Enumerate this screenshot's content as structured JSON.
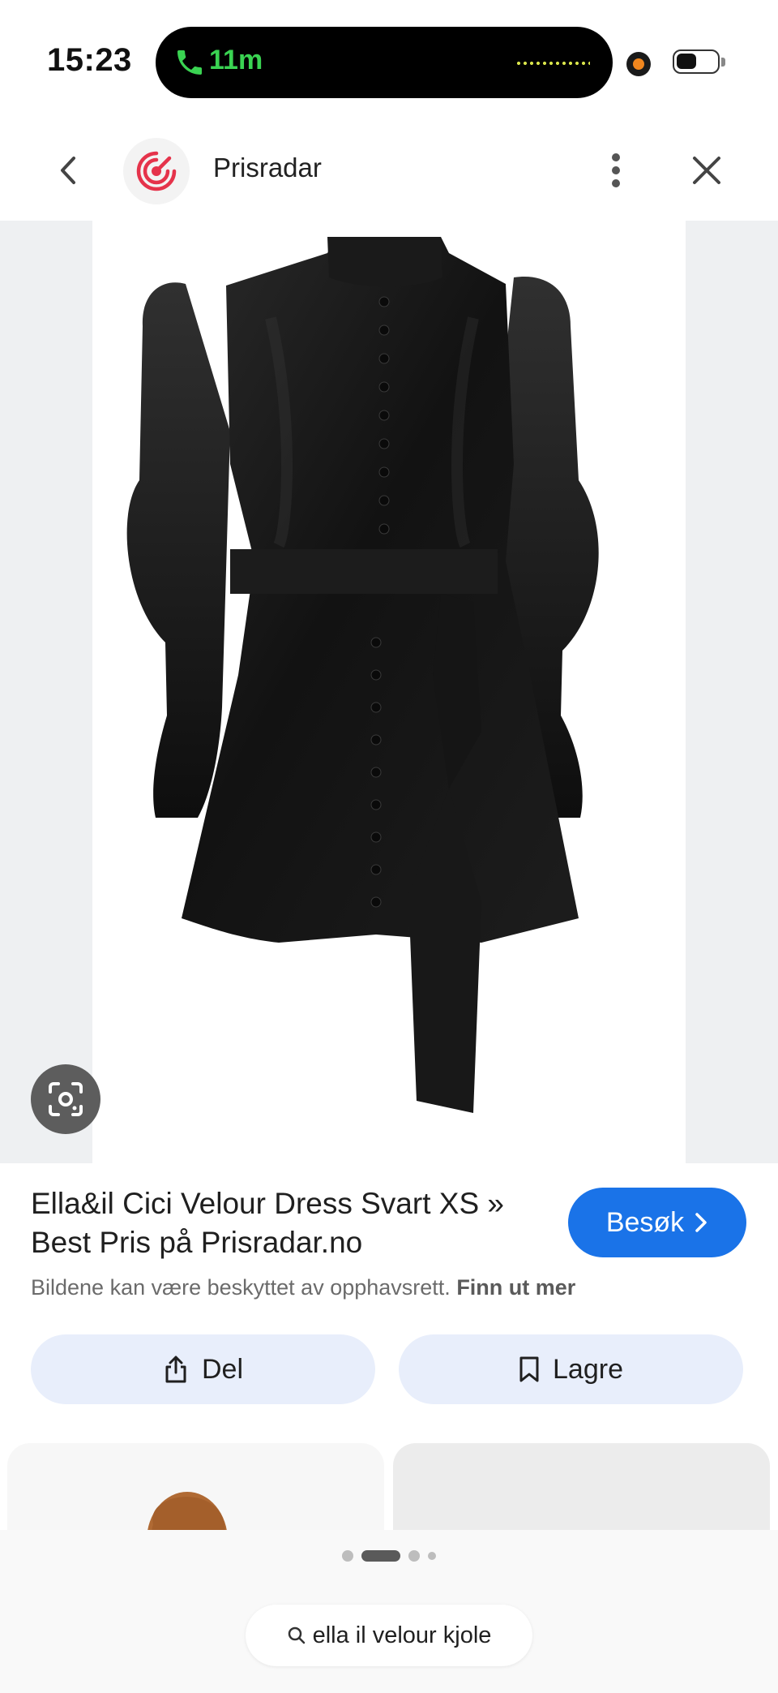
{
  "status_bar": {
    "time": "15:23",
    "call_duration": "11m"
  },
  "header": {
    "site_name": "Prisradar"
  },
  "result": {
    "title": "Ella&il Cici Velour Dress Svart XS » Best Pris på Prisradar.no",
    "visit_label": "Besøk",
    "copyright_text": "Bildene kan være beskyttet av opphavsrett.",
    "learn_more_label": "Finn ut mer"
  },
  "actions": {
    "share_label": "Del",
    "save_label": "Lagre"
  },
  "pagination": {
    "count": 4,
    "active_index": 1
  },
  "search": {
    "query": "ella il velour kjole"
  },
  "colors": {
    "accent": "#1a73e8",
    "action_bg": "#e8eefb",
    "call_green": "#3ad352",
    "logo_red": "#e5334b"
  },
  "icons": {
    "back": "chevron-left-icon",
    "more": "more-vertical-icon",
    "close": "close-icon",
    "lens": "google-lens-icon",
    "share": "share-icon",
    "save": "bookmark-icon",
    "search": "search-icon",
    "visit": "chevron-right-icon"
  }
}
